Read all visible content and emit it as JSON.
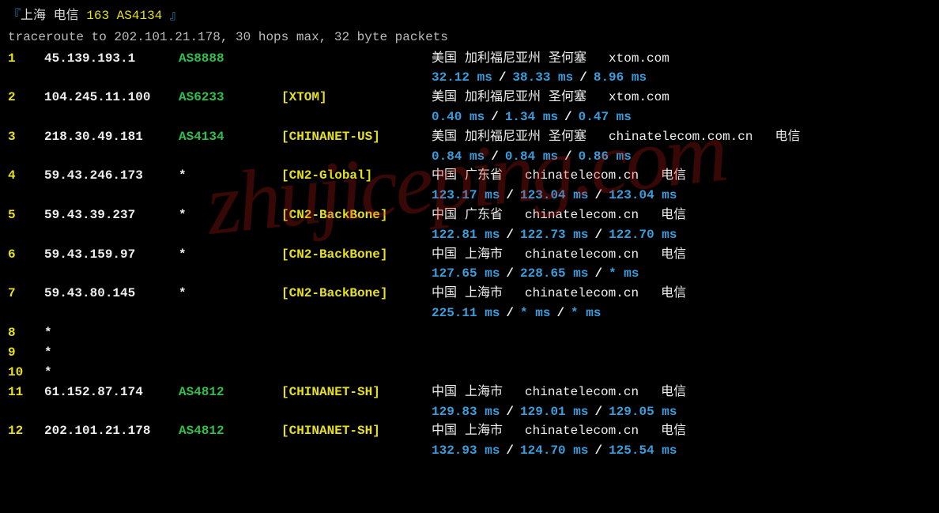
{
  "header": {
    "bracket_open": "『",
    "loc": "上海 电信",
    "asn_num": "163",
    "asn": "AS4134",
    "bracket_close": "』"
  },
  "subheader": "traceroute to 202.101.21.178, 30 hops max, 32 byte packets",
  "watermark": "zhujiceping.com",
  "hops": [
    {
      "num": "1",
      "ip": "45.139.193.1",
      "asn": "AS8888",
      "net": "",
      "country": "美国",
      "region": "加利福尼亚州",
      "city": "圣何塞",
      "domain": "xtom.com",
      "isp": "",
      "lat": [
        "32.12 ms",
        "38.33 ms",
        "8.96 ms"
      ]
    },
    {
      "num": "2",
      "ip": "104.245.11.100",
      "asn": "AS6233",
      "net": "[XTOM]",
      "country": "美国",
      "region": "加利福尼亚州",
      "city": "圣何塞",
      "domain": "xtom.com",
      "isp": "",
      "lat": [
        "0.40 ms",
        "1.34 ms",
        "0.47 ms"
      ]
    },
    {
      "num": "3",
      "ip": "218.30.49.181",
      "asn": "AS4134",
      "net": "[CHINANET-US]",
      "country": "美国",
      "region": "加利福尼亚州",
      "city": "圣何塞",
      "domain": "chinatelecom.com.cn",
      "isp": "电信",
      "lat": [
        "0.84 ms",
        "0.84 ms",
        "0.86 ms"
      ]
    },
    {
      "num": "4",
      "ip": "59.43.246.173",
      "asn": "*",
      "net": "[CN2-Global]",
      "country": "中国",
      "region": "广东省",
      "city": "",
      "domain": "chinatelecom.cn",
      "isp": "电信",
      "lat": [
        "123.17 ms",
        "123.04 ms",
        "123.04 ms"
      ]
    },
    {
      "num": "5",
      "ip": "59.43.39.237",
      "asn": "*",
      "net": "[CN2-BackBone]",
      "country": "中国",
      "region": "广东省",
      "city": "",
      "domain": "chinatelecom.cn",
      "isp": "电信",
      "lat": [
        "122.81 ms",
        "122.73 ms",
        "122.70 ms"
      ]
    },
    {
      "num": "6",
      "ip": "59.43.159.97",
      "asn": "*",
      "net": "[CN2-BackBone]",
      "country": "中国",
      "region": "上海市",
      "city": "",
      "domain": "chinatelecom.cn",
      "isp": "电信",
      "lat": [
        "127.65 ms",
        "228.65 ms",
        "* ms"
      ]
    },
    {
      "num": "7",
      "ip": "59.43.80.145",
      "asn": "*",
      "net": "[CN2-BackBone]",
      "country": "中国",
      "region": "上海市",
      "city": "",
      "domain": "chinatelecom.cn",
      "isp": "电信",
      "lat": [
        "225.11 ms",
        "* ms",
        "* ms"
      ]
    },
    {
      "num": "8",
      "ip": "*",
      "empty": true
    },
    {
      "num": "9",
      "ip": "*",
      "empty": true
    },
    {
      "num": "10",
      "ip": "*",
      "empty": true
    },
    {
      "num": "11",
      "ip": "61.152.87.174",
      "asn": "AS4812",
      "net": "[CHINANET-SH]",
      "country": "中国",
      "region": "上海市",
      "city": "",
      "domain": "chinatelecom.cn",
      "isp": "电信",
      "lat": [
        "129.83 ms",
        "129.01 ms",
        "129.05 ms"
      ]
    },
    {
      "num": "12",
      "ip": "202.101.21.178",
      "asn": "AS4812",
      "net": "[CHINANET-SH]",
      "country": "中国",
      "region": "上海市",
      "city": "",
      "domain": "chinatelecom.cn",
      "isp": "电信",
      "lat": [
        "132.93 ms",
        "124.70 ms",
        "125.54 ms"
      ]
    }
  ]
}
